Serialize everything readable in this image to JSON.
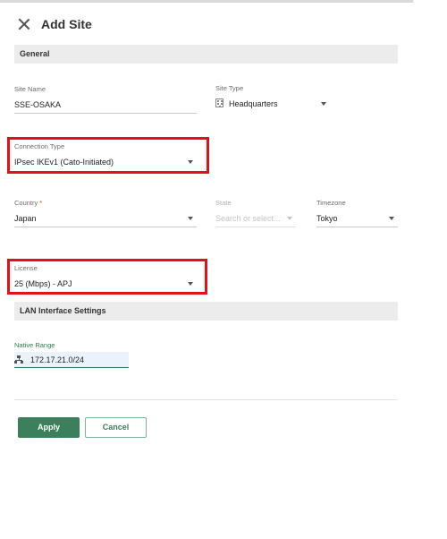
{
  "dialog": {
    "title": "Add Site"
  },
  "sections": {
    "general": "General",
    "lan": "LAN Interface Settings"
  },
  "fields": {
    "site_name": {
      "label": "Site Name",
      "value": "SSE-OSAKA"
    },
    "site_type": {
      "label": "Site Type",
      "value": "Headquarters"
    },
    "connection_type": {
      "label": "Connection Type",
      "value": "IPsec IKEv1 (Cato-Initiated)"
    },
    "country": {
      "label": "Country",
      "required_mark": "*",
      "value": "Japan"
    },
    "state": {
      "label": "State",
      "placeholder": "Search or select..."
    },
    "timezone": {
      "label": "Timezone",
      "value": "Tokyo"
    },
    "license": {
      "label": "License",
      "value": "25 (Mbps) - APJ"
    },
    "native_range": {
      "label": "Native Range",
      "value": "172.17.21.0/24"
    }
  },
  "buttons": {
    "apply": "Apply",
    "cancel": "Cancel"
  },
  "colors": {
    "accent": "#3c7f5c",
    "highlight": "#e3101b",
    "section_bg": "#ececec"
  },
  "icons": {
    "close": "close-icon",
    "site_type": "building-icon",
    "native_range": "network-icon"
  }
}
